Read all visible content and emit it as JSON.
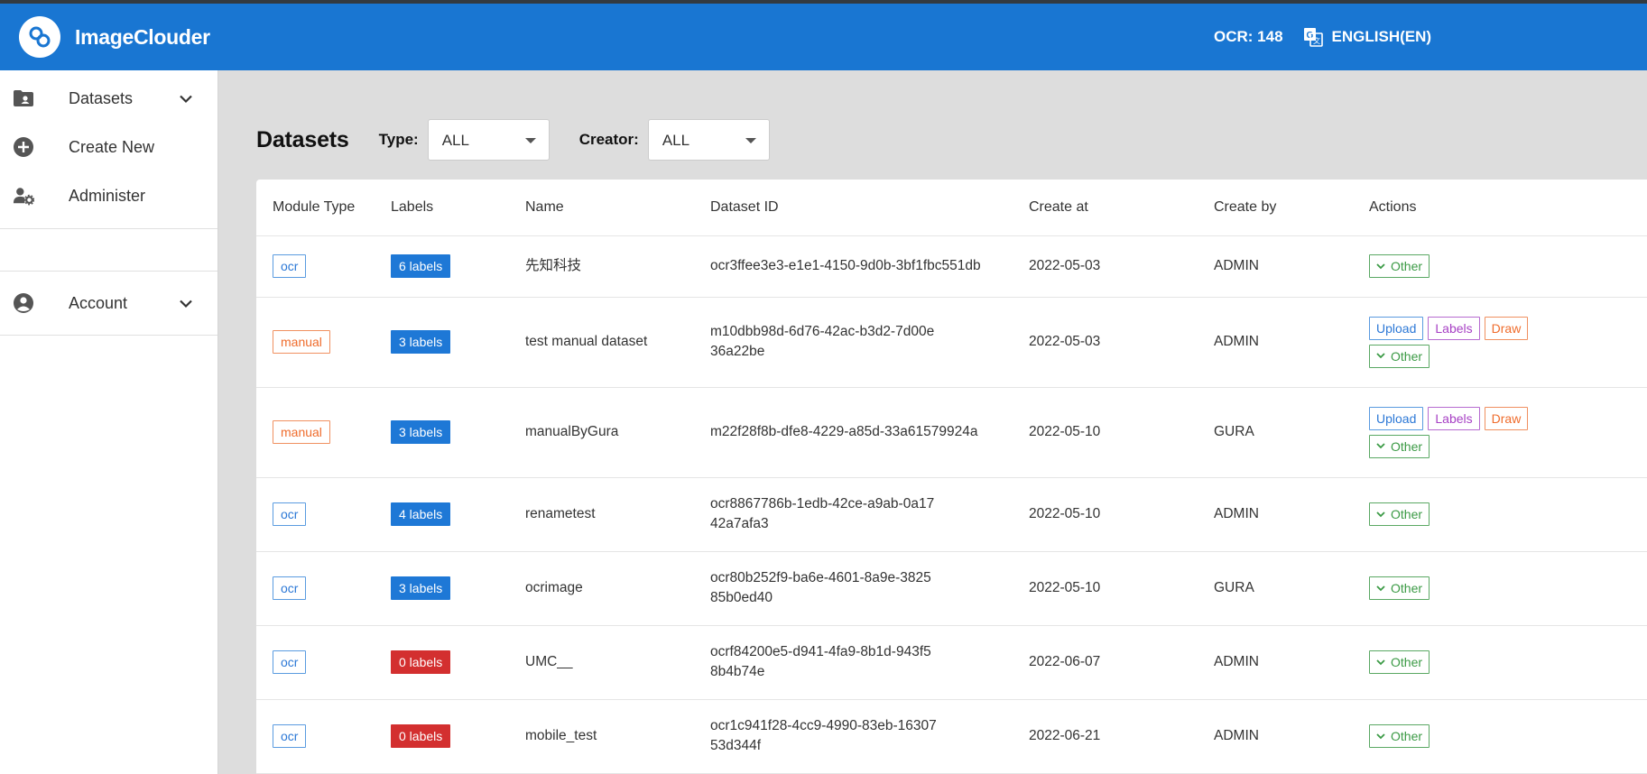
{
  "header": {
    "app_title": "ImageClouder",
    "ocr_count": "OCR: 148",
    "language": "ENGLISH(EN)"
  },
  "sidebar": {
    "items": [
      {
        "label": "Datasets",
        "icon": "folder-icon"
      },
      {
        "label": "Create New",
        "icon": "plus-circle-icon"
      },
      {
        "label": "Administer",
        "icon": "user-gear-icon"
      },
      {
        "label": "Account",
        "icon": "account-circle-icon"
      }
    ]
  },
  "toolbar": {
    "title": "Datasets",
    "type_label": "Type:",
    "type_value": "ALL",
    "creator_label": "Creator:",
    "creator_value": "ALL"
  },
  "table": {
    "columns": [
      "Module Type",
      "Labels",
      "Name",
      "Dataset ID",
      "Create at",
      "Create by",
      "Actions"
    ],
    "rows": [
      {
        "module": "ocr",
        "labels": "6 labels",
        "name": "先知科技",
        "dataset_id": "ocr3ffee3e3-e1e1-4150-9d0b-3bf1fbc551db",
        "created_at": "2022-05-03",
        "created_by": "ADMIN"
      },
      {
        "module": "manual",
        "labels": "3 labels",
        "name": "test manual dataset",
        "dataset_id": "m10dbb98d-6d76-42ac-b3d2-7d00e36a22be",
        "created_at": "2022-05-03",
        "created_by": "ADMIN"
      },
      {
        "module": "manual",
        "labels": "3 labels",
        "name": "manualByGura",
        "dataset_id": "m22f28f8b-dfe8-4229-a85d-33a61579924a",
        "created_at": "2022-05-10",
        "created_by": "GURA"
      },
      {
        "module": "ocr",
        "labels": "4 labels",
        "name": "renametest",
        "dataset_id": "ocr8867786b-1edb-42ce-a9ab-0a1742a7afa3",
        "created_at": "2022-05-10",
        "created_by": "ADMIN"
      },
      {
        "module": "ocr",
        "labels": "3 labels",
        "name": "ocrimage",
        "dataset_id": "ocr80b252f9-ba6e-4601-8a9e-382585b0ed40",
        "created_at": "2022-05-10",
        "created_by": "GURA"
      },
      {
        "module": "ocr",
        "labels": "0 labels",
        "name": "UMC__",
        "dataset_id": "ocrf84200e5-d941-4fa9-8b1d-943f58b4b74e",
        "created_at": "2022-06-07",
        "created_by": "ADMIN"
      },
      {
        "module": "ocr",
        "labels": "0 labels",
        "name": "mobile_test",
        "dataset_id": "ocr1c941f28-4cc9-4990-83eb-1630753d344f",
        "created_at": "2022-06-21",
        "created_by": "ADMIN"
      }
    ]
  },
  "actions": {
    "upload": "Upload",
    "labels": "Labels",
    "draw": "Draw",
    "other": "Other"
  },
  "colors": {
    "header_bg": "#1976d2",
    "ocr_badge": "#2c78d6",
    "manual_badge": "#ef6c2c",
    "labels_blue": "#1e78d6",
    "labels_red": "#d32f2f",
    "other_green": "#3b9a45",
    "labels_purple": "#a63fc4"
  }
}
